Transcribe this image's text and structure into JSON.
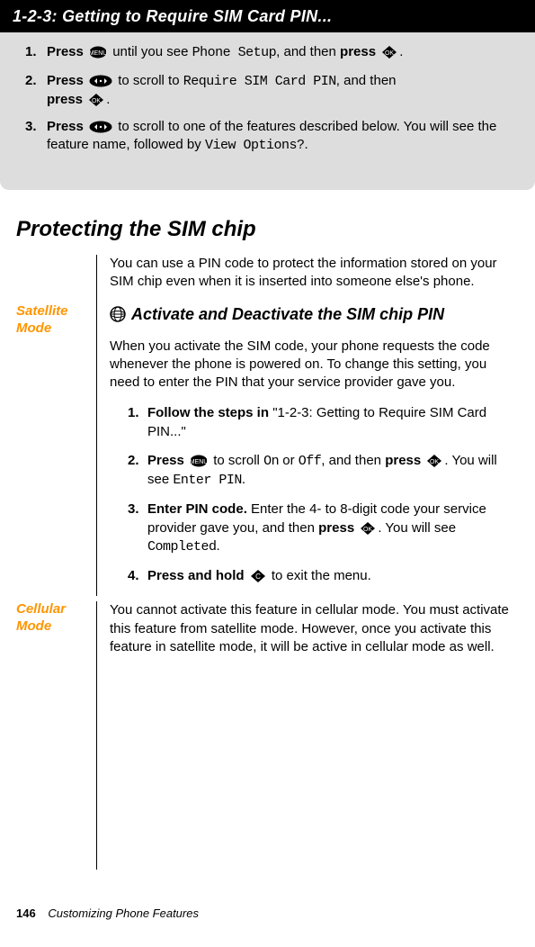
{
  "header": {
    "title": "1-2-3: Getting to Require SIM Card PIN..."
  },
  "steps123": {
    "s1_a": "Press ",
    "s1_b": " until you see ",
    "s1_lcd": "Phone Setup",
    "s1_c": ", and then ",
    "s1_press": "press ",
    "s1_d": ".",
    "s2_a": "Press ",
    "s2_b": " to scroll to ",
    "s2_lcd": "Require SIM Card PIN",
    "s2_c": ", and then ",
    "s2_press": "press ",
    "s2_d": ".",
    "s3_a": "Press ",
    "s3_b": " to scroll to one of the features described below. You will see the feature name, followed by ",
    "s3_lcd": "View Options?",
    "s3_c": "."
  },
  "section": {
    "title": "Protecting the SIM chip"
  },
  "intro": "You can use a PIN code to protect the information stored on your SIM chip even when it is inserted into someone else's phone.",
  "satellite": {
    "label": "Satellite Mode",
    "subhead": "Activate and Deactivate the SIM chip PIN",
    "para": "When you activate the SIM code, your phone requests the code whenever the phone is powered on. To change this setting, you need to enter the PIN that your service provider gave you.",
    "s1_a": "Follow the steps in ",
    "s1_b": "\"1-2-3: Getting to Require SIM Card PIN...\"",
    "s2_a": "Press ",
    "s2_b": " to scroll ",
    "s2_on": "On",
    "s2_or": " or ",
    "s2_off": "Off",
    "s2_c": ", and then ",
    "s2_press": "press ",
    "s2_d": ". You will see ",
    "s2_lcd": "Enter PIN",
    "s2_e": ".",
    "s3_a": "Enter PIN code.",
    "s3_b": " Enter the 4- to 8-digit code your service provider gave you, and then ",
    "s3_press": "press ",
    "s3_c": ". You will see ",
    "s3_lcd": "Completed",
    "s3_d": ".",
    "s4_a": "Press and hold ",
    "s4_b": " to exit the menu."
  },
  "cellular": {
    "label": "Cellular Mode",
    "para": "You cannot activate this feature in cellular mode. You must activate this feature from satellite mode. However, once you activate this feature in satellite mode, it will be active in cellular mode as well."
  },
  "footer": {
    "page": "146",
    "chapter": "Customizing Phone Features"
  }
}
